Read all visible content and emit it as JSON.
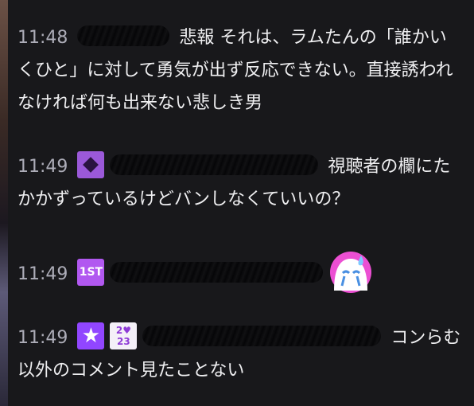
{
  "messages": [
    {
      "time": "11:48",
      "text": "悲報 それは、ラムたんの「誰かいくひと」に対して勇気が出ず反応できない。直接誘われなければ何も出来ない悲しき男"
    },
    {
      "time": "11:49",
      "text": "視聴者の欄にたかかずっているけどバンしなくていいの？"
    },
    {
      "time": "11:49",
      "text": ""
    },
    {
      "time": "11:49",
      "text": "コンらむ以外のコメント見たことない"
    }
  ],
  "badges": {
    "first": "1ST",
    "star": "★",
    "year_top": "2♥",
    "year_bottom": "23"
  }
}
